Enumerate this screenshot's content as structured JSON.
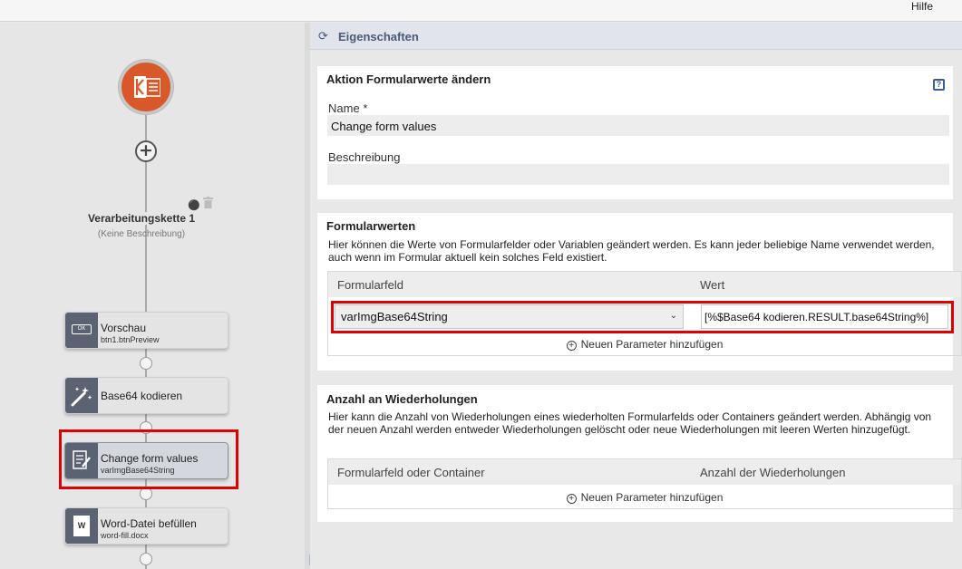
{
  "topbar": {
    "help_label": "Hilfe"
  },
  "flow": {
    "chain_title": "Verarbeitungskette 1",
    "chain_description": "(Keine Beschreibung)",
    "nodes": [
      {
        "title": "Vorschau",
        "subtitle": "btn1.btnPreview",
        "icon_text": "OK"
      },
      {
        "title": "Base64 kodieren",
        "subtitle": ""
      },
      {
        "title": "Change form values",
        "subtitle": "varImgBase64String"
      },
      {
        "title": "Word-Datei befüllen",
        "subtitle": "word-fill.docx",
        "icon_text": "W"
      }
    ]
  },
  "panel": {
    "title": "Eigenschaften",
    "action": {
      "heading": "Aktion Formularwerte ändern",
      "name_label": "Name",
      "required_marker": "*",
      "name_value": "Change form values",
      "description_label": "Beschreibung",
      "description_value": ""
    },
    "formvalues": {
      "heading": "Formularwerten",
      "description": "Hier können die Werte von Formularfelder oder Variablen geändert werden. Es kann jeder beliebige Name verwendet werden, auch wenn im Formular aktuell kein solches Feld existiert.",
      "columns": [
        "Formularfeld",
        "Wert"
      ],
      "rows": [
        {
          "field": "varImgBase64String",
          "value": "[%$Base64 kodieren.RESULT.base64String%]"
        }
      ],
      "add_label": "Neuen Parameter hinzufügen"
    },
    "repeats": {
      "heading": "Anzahl an Wiederholungen",
      "description": "Hier kann die Anzahl von Wiederholungen eines wiederholten Formularfelds oder Containers geändert werden. Abhängig von der neuen Anzahl werden entweder Wiederholungen gelöscht oder neue Wiederholungen mit leeren Werten hinzugefügt.",
      "columns": [
        "Formularfeld oder Container",
        "Anzahl der Wiederholungen"
      ],
      "add_label": "Neuen Parameter hinzufügen"
    }
  },
  "colors": {
    "start_orange": "#d9582a",
    "node_icon_bg": "#5b6372",
    "highlight_red": "#e00000",
    "panel_header_text": "#4a5a78"
  }
}
